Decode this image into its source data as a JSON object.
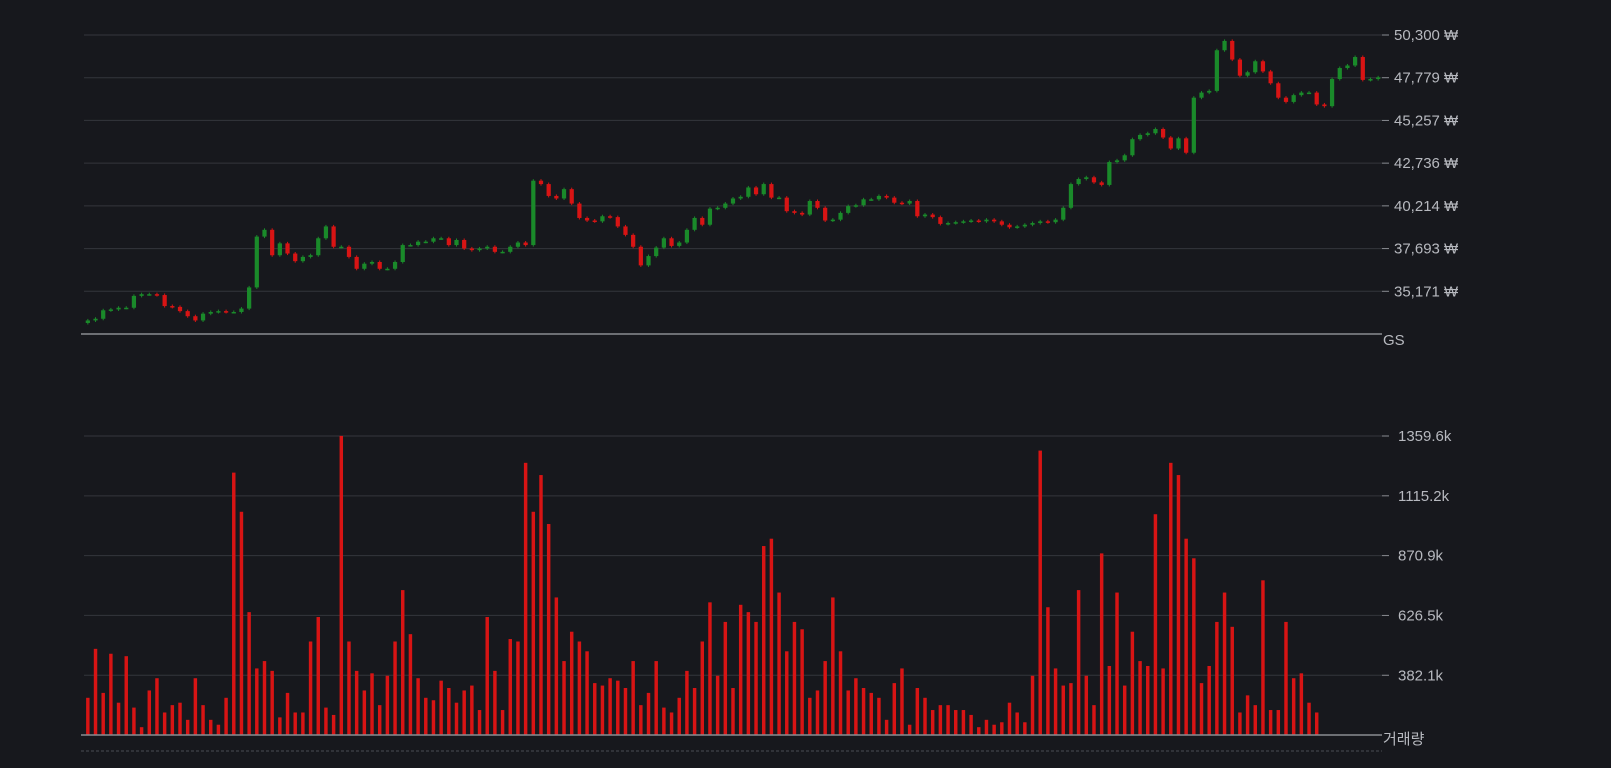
{
  "colors": {
    "background": "#17181d",
    "grid": "#34363d",
    "axis": "#8a8c92",
    "text": "#b7b9bf",
    "up": "#1a8a2a",
    "down": "#d81414",
    "volume": "#d81414"
  },
  "chart_data": [
    {
      "type": "candlestick",
      "title": "",
      "axis_label": "GS",
      "ylabels": [
        "50,300 ₩",
        "47,779 ₩",
        "45,257 ₩",
        "42,736 ₩",
        "40,214 ₩",
        "37,693 ₩",
        "35,171 ₩"
      ],
      "ylevels": [
        50300,
        47779,
        45257,
        42736,
        40214,
        37693,
        35171
      ],
      "ylim": [
        32650,
        50300
      ],
      "grid": true,
      "closes": [
        33450,
        33550,
        34050,
        34100,
        34200,
        34200,
        34900,
        35000,
        35000,
        34950,
        34300,
        34250,
        34000,
        33700,
        33450,
        33850,
        33950,
        34000,
        33950,
        33950,
        34150,
        35400,
        38400,
        38800,
        37300,
        38000,
        37400,
        36950,
        37200,
        37300,
        38300,
        39000,
        37800,
        37800,
        37200,
        36500,
        36800,
        36900,
        36500,
        36500,
        36900,
        37900,
        37900,
        38100,
        38100,
        38300,
        38300,
        37900,
        38200,
        37700,
        37600,
        37700,
        37800,
        37500,
        37500,
        37800,
        38050,
        37900,
        41700,
        41500,
        40800,
        40650,
        41200,
        40350,
        39500,
        39350,
        39300,
        39600,
        39550,
        39000,
        38500,
        37800,
        36700,
        37250,
        37750,
        38300,
        37850,
        38050,
        38800,
        39500,
        39100,
        40050,
        40100,
        40350,
        40650,
        40750,
        41300,
        40900,
        41500,
        40700,
        40700,
        39900,
        39800,
        39700,
        40500,
        40100,
        39350,
        39400,
        39800,
        40200,
        40250,
        40600,
        40600,
        40800,
        40700,
        40400,
        40350,
        40500,
        39600,
        39700,
        39550,
        39150,
        39200,
        39250,
        39300,
        39350,
        39300,
        39400,
        39300,
        39100,
        38950,
        39000,
        39100,
        39200,
        39300,
        39250,
        39400,
        40100,
        41500,
        41800,
        41900,
        41600,
        41450,
        42800,
        42900,
        43200,
        44150,
        44400,
        44500,
        44750,
        44250,
        43600,
        44200,
        43350,
        46600,
        46900,
        47000,
        49400,
        49950,
        48850,
        47900,
        48100,
        48750,
        48150,
        47450,
        46600,
        46350,
        46750,
        46900,
        46900,
        46200,
        46100,
        47700,
        48350,
        48500,
        49000,
        47650,
        47700,
        47800
      ],
      "yscale_note": "",
      "volume": {
        "type": "bar",
        "axis_label": "거래량",
        "ylabels": [
          "1359.6k",
          "1115.2k",
          "870.9k",
          "626.5k",
          "382.1k"
        ],
        "ylevels": [
          1359.6,
          1115.2,
          870.9,
          626.5,
          382.1
        ],
        "ylim": [
          138,
          1359.6
        ],
        "values": [
          290,
          490,
          310,
          470,
          270,
          460,
          250,
          170,
          320,
          370,
          230,
          260,
          270,
          200,
          370,
          260,
          200,
          180,
          290,
          1210,
          1050,
          640,
          410,
          440,
          400,
          210,
          310,
          230,
          230,
          520,
          620,
          250,
          220,
          1360,
          520,
          400,
          320,
          390,
          260,
          380,
          520,
          730,
          550,
          370,
          290,
          280,
          360,
          330,
          270,
          320,
          340,
          240,
          620,
          400,
          240,
          530,
          520,
          1250,
          1050,
          1200,
          1000,
          700,
          440,
          560,
          520,
          480,
          350,
          340,
          370,
          360,
          330,
          440,
          260,
          310,
          440,
          250,
          230,
          290,
          400,
          330,
          520,
          680,
          380,
          600,
          330,
          670,
          640,
          600,
          910,
          940,
          720,
          480,
          600,
          570,
          290,
          320,
          440,
          700,
          480,
          320,
          370,
          330,
          310,
          290,
          200,
          350,
          410,
          180,
          330,
          290,
          240,
          260,
          260,
          240,
          240,
          220,
          170,
          200,
          180,
          190,
          270,
          230,
          190,
          380,
          1300,
          660,
          410,
          340,
          350,
          730,
          380,
          260,
          880,
          420,
          720,
          340,
          560,
          440,
          420,
          1040,
          410,
          1250,
          1200,
          940,
          860,
          350,
          420,
          600,
          720,
          580,
          230,
          300,
          260,
          770,
          240,
          240,
          600,
          370,
          390,
          270,
          230
        ]
      }
    }
  ]
}
